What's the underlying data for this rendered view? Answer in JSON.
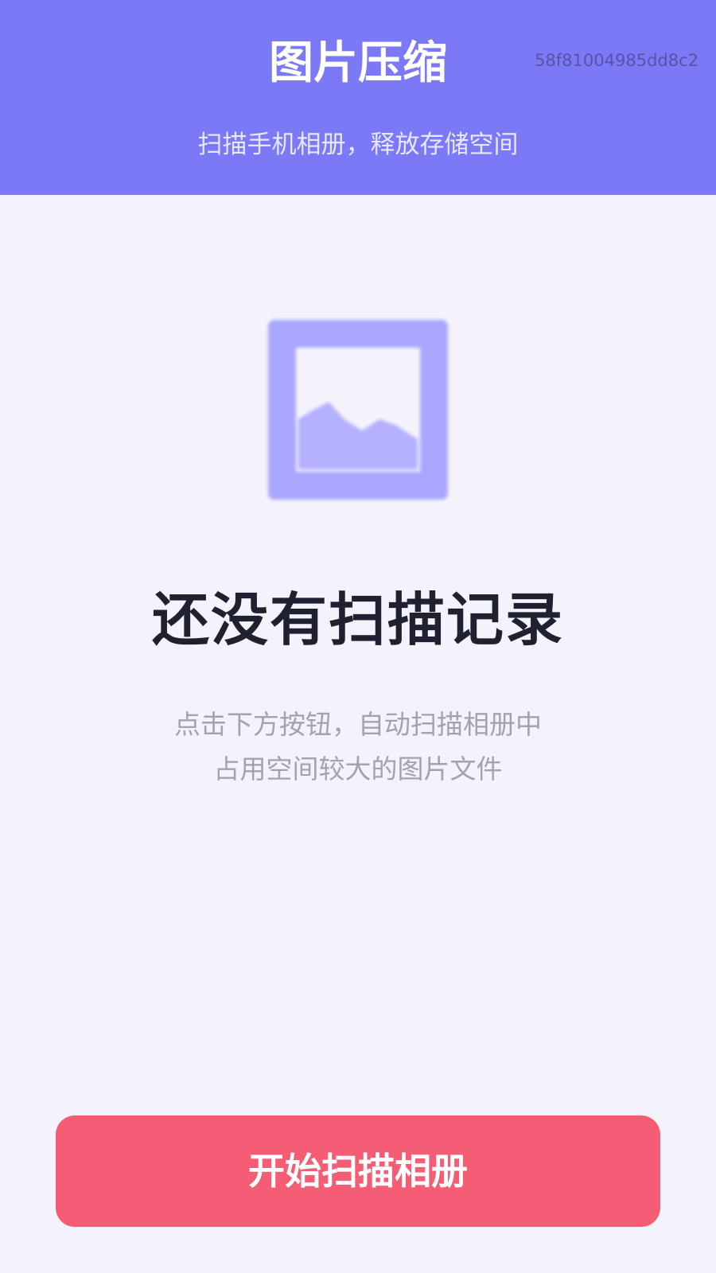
{
  "header": {
    "title": "图片压缩",
    "subtitle": "扫描手机相册，释放存储空间",
    "hash": "58f81004985dd8c2"
  },
  "empty_state": {
    "icon": "image-placeholder-icon",
    "title": "还没有扫描记录",
    "description": [
      "点击下方按钮，自动扫描相册中",
      "占用空间较大的图片文件"
    ]
  },
  "actions": {
    "start_scan_label": "开始扫描相册"
  },
  "colors": {
    "header": "#7b79f5",
    "background": "#f4f3fb",
    "illustration": "#a9a6ff",
    "button": "#f45d74",
    "title": "#1f2030",
    "description": "#a3a3ad"
  }
}
